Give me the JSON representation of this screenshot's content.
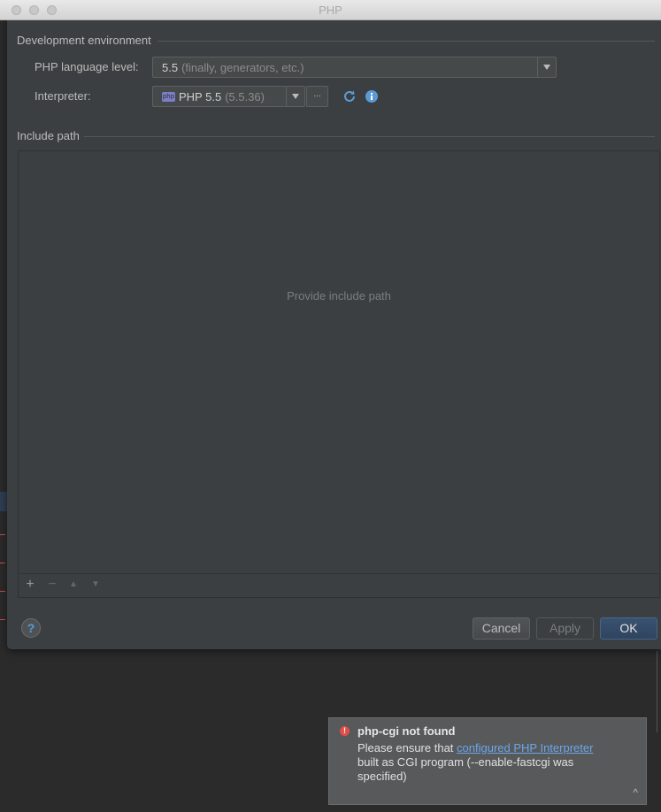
{
  "window": {
    "title": "PHP"
  },
  "dev_env": {
    "section_title": "Development environment",
    "language_level_label": "PHP language level:",
    "language_level_value": "5.5",
    "language_level_hint": "(finally, generators, etc.)",
    "interpreter_label": "Interpreter:",
    "interpreter_value": "PHP 5.5",
    "interpreter_version": "(5.5.36)",
    "browse_label": "...",
    "php_badge": "php"
  },
  "include_path": {
    "section_title": "Include path",
    "empty_text": "Provide include path",
    "toolbar": {
      "add": "+",
      "remove": "−",
      "up": "▲",
      "down": "▼"
    }
  },
  "footer": {
    "help_label": "?",
    "cancel_label": "Cancel",
    "apply_label": "Apply",
    "ok_label": "OK"
  },
  "notification": {
    "title": "php-cgi not found",
    "body_prefix": "Please ensure that ",
    "link_text": "configured PHP Interpreter",
    "body_suffix": "built as CGI program (--enable-fastcgi was specified)",
    "icon_text": "!",
    "collapse": "^"
  },
  "colors": {
    "accent": "#5b9bd5",
    "error": "#e14d48",
    "link": "#6ba6e8",
    "dialog_bg": "#3c3f41"
  }
}
